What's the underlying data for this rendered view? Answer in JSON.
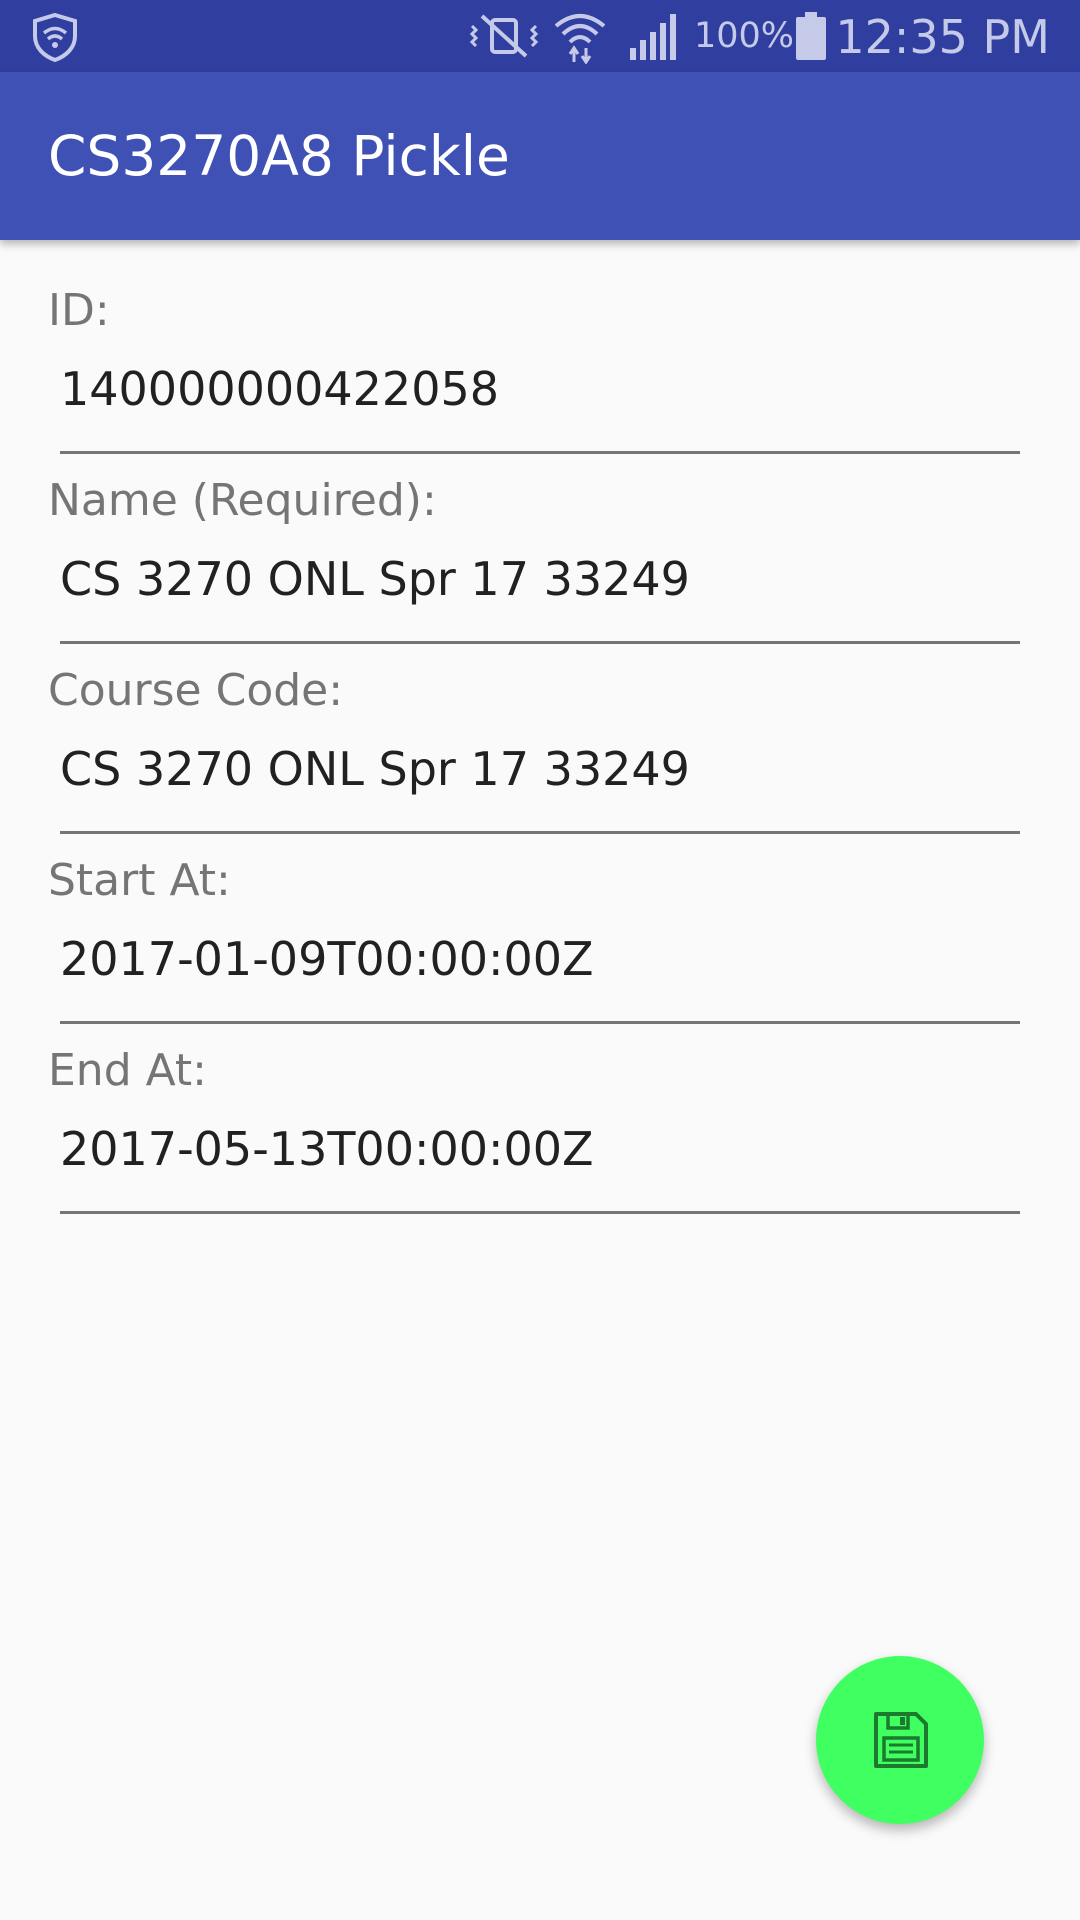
{
  "status_bar": {
    "icons": [
      "shield-icon",
      "vibrate-mute-icon",
      "wifi-icon",
      "signal-icon",
      "battery-icon"
    ],
    "battery_percent": "100%",
    "time": "12:35 PM"
  },
  "app_bar": {
    "title": "CS3270A8 Pickle",
    "color": "#3F51B5"
  },
  "form": {
    "fields": [
      {
        "label": "ID:",
        "value": "140000000422058"
      },
      {
        "label": "Name (Required):",
        "value": "CS 3270 ONL Spr 17 33249"
      },
      {
        "label": "Course Code:",
        "value": "CS 3270 ONL Spr 17 33249"
      },
      {
        "label": "Start At:",
        "value": "2017-01-09T00:00:00Z"
      },
      {
        "label": "End At:",
        "value": "2017-05-13T00:00:00Z"
      }
    ]
  },
  "fab": {
    "icon": "save-icon",
    "color": "#40FF60"
  }
}
